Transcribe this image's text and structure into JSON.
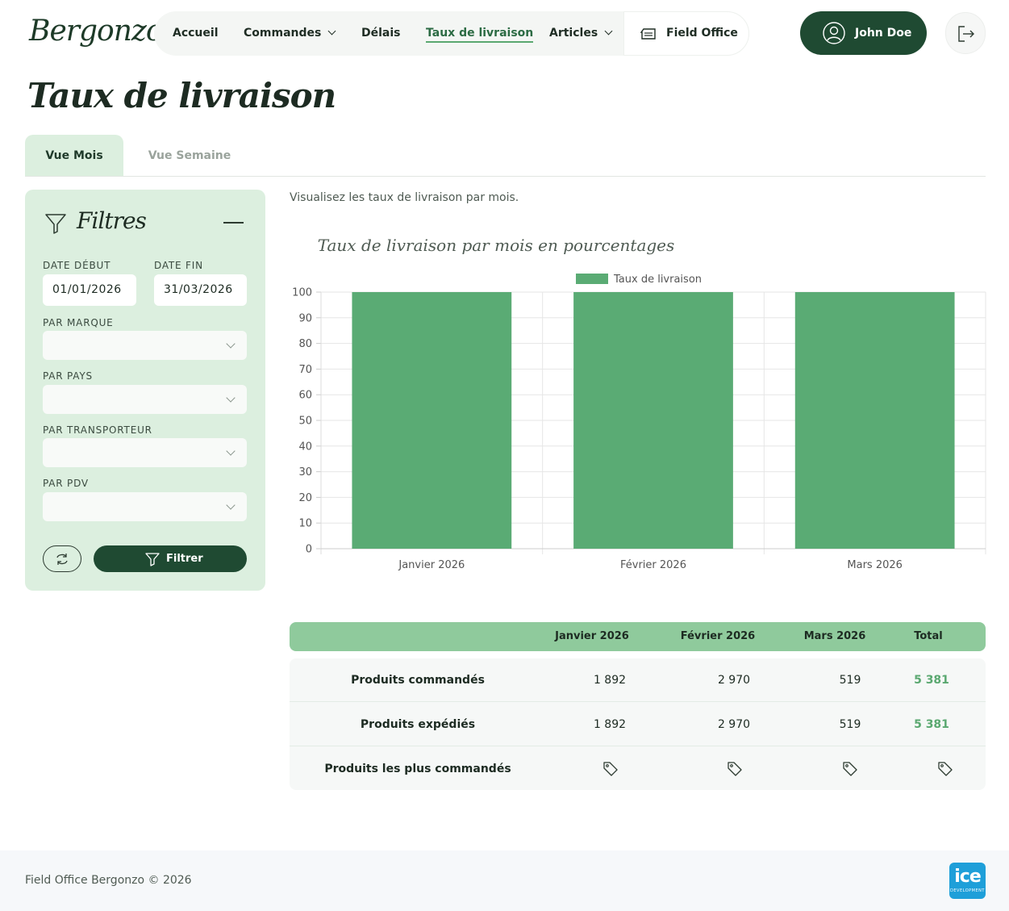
{
  "brand": {
    "logo": "Bergonzo"
  },
  "nav": {
    "items": [
      {
        "label": "Accueil"
      },
      {
        "label": "Commandes"
      },
      {
        "label": "Délais"
      },
      {
        "label": "Taux de livraison"
      },
      {
        "label": "Articles"
      }
    ],
    "office": "Field Office"
  },
  "user": {
    "name": "John Doe"
  },
  "page": {
    "title": "Taux de livraison"
  },
  "tabs": {
    "month": "Vue Mois",
    "week": "Vue Semaine"
  },
  "filters": {
    "title": "Filtres",
    "date_start_label": "DATE DÉBUT",
    "date_start_value": "01/01/2026",
    "date_end_label": "DATE FIN",
    "date_end_value": "31/03/2026",
    "brand_label": "PAR MARQUE",
    "country_label": "PAR PAYS",
    "carrier_label": "PAR TRANSPORTEUR",
    "pos_label": "PAR PDV",
    "filter_button": "Filtrer"
  },
  "main": {
    "subtitle": "Visualisez les taux de livraison par mois."
  },
  "chart_data": {
    "type": "bar",
    "title": "Taux de livraison par mois en pourcentages",
    "categories": [
      "Janvier 2026",
      "Février 2026",
      "Mars 2026"
    ],
    "series": [
      {
        "name": "Taux de livraison",
        "values": [
          100,
          100,
          100
        ]
      }
    ],
    "ylim": [
      0,
      100
    ],
    "yticks": [
      0,
      10,
      20,
      30,
      40,
      50,
      60,
      70,
      80,
      90,
      100
    ],
    "grid": true,
    "legend": "top",
    "color": "#5aab74"
  },
  "table": {
    "headers": [
      "Janvier 2026",
      "Février 2026",
      "Mars 2026",
      "Total"
    ],
    "rows": [
      {
        "label": "Produits commandés",
        "values": [
          "1 892",
          "2 970",
          "519",
          "5 381"
        ]
      },
      {
        "label": "Produits expédiés",
        "values": [
          "1 892",
          "2 970",
          "519",
          "5 381"
        ]
      },
      {
        "label": "Produits les plus commandés",
        "icons": [
          "tag-icon",
          "tag-icon",
          "tag-icon",
          "tag-icon"
        ]
      }
    ]
  },
  "footer": {
    "text": "Field Office Bergonzo © 2026",
    "badge": "ice",
    "badge_sub": "DEVELOPMENT"
  }
}
